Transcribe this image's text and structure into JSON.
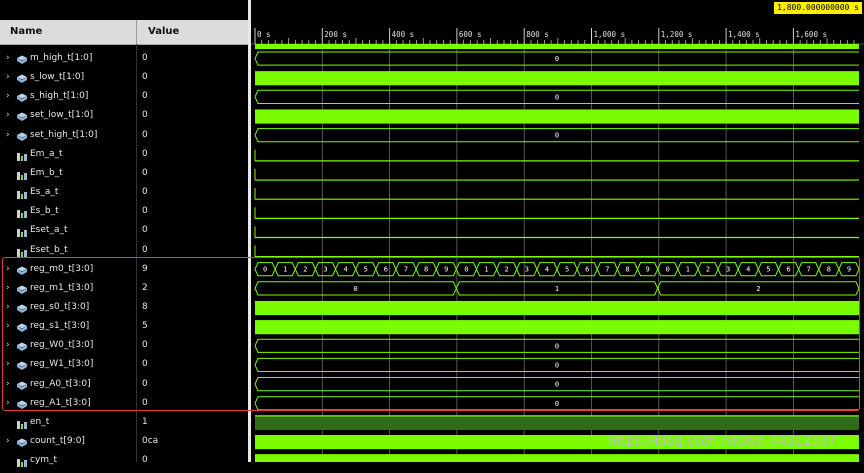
{
  "header": {
    "name_label": "Name",
    "value_label": "Value"
  },
  "cursor_time": "1,800.000000000 s",
  "ruler_ticks": [
    "0 s",
    "200 s",
    "400 s",
    "600 s",
    "800 s",
    "1,000 s",
    "1,200 s",
    "1,400 s",
    "1,600 s"
  ],
  "signals": [
    {
      "name": "m_high_t[1:0]",
      "value": "0",
      "bus": true,
      "kind": "bus",
      "text": "0"
    },
    {
      "name": "s_low_t[1:0]",
      "value": "0",
      "bus": true,
      "kind": "solid"
    },
    {
      "name": "s_high_t[1:0]",
      "value": "0",
      "bus": true,
      "kind": "bus",
      "text": "0"
    },
    {
      "name": "set_low_t[1:0]",
      "value": "0",
      "bus": true,
      "kind": "solid"
    },
    {
      "name": "set_high_t[1:0]",
      "value": "0",
      "bus": true,
      "kind": "bus",
      "text": "0"
    },
    {
      "name": "Em_a_t",
      "value": "0",
      "bus": false,
      "kind": "low"
    },
    {
      "name": "Em_b_t",
      "value": "0",
      "bus": false,
      "kind": "low"
    },
    {
      "name": "Es_a_t",
      "value": "0",
      "bus": false,
      "kind": "low"
    },
    {
      "name": "Es_b_t",
      "value": "0",
      "bus": false,
      "kind": "low"
    },
    {
      "name": "Eset_a_t",
      "value": "0",
      "bus": false,
      "kind": "low"
    },
    {
      "name": "Eset_b_t",
      "value": "0",
      "bus": false,
      "kind": "low"
    },
    {
      "name": "reg_m0_t[3:0]",
      "value": "9",
      "bus": true,
      "kind": "counter",
      "segments": [
        "0",
        "1",
        "2",
        "3",
        "4",
        "5",
        "6",
        "7",
        "8",
        "9",
        "0",
        "1",
        "2",
        "3",
        "4",
        "5",
        "6",
        "7",
        "8",
        "9",
        "0",
        "1",
        "2",
        "3",
        "4",
        "5",
        "6",
        "7",
        "8",
        "9"
      ]
    },
    {
      "name": "reg_m1_t[3:0]",
      "value": "2",
      "bus": true,
      "kind": "segments",
      "segments": [
        "0",
        "1",
        "2"
      ]
    },
    {
      "name": "reg_s0_t[3:0]",
      "value": "8",
      "bus": true,
      "kind": "solid"
    },
    {
      "name": "reg_s1_t[3:0]",
      "value": "5",
      "bus": true,
      "kind": "solid"
    },
    {
      "name": "reg_W0_t[3:0]",
      "value": "0",
      "bus": true,
      "kind": "bus",
      "text": "0"
    },
    {
      "name": "reg_W1_t[3:0]",
      "value": "0",
      "bus": true,
      "kind": "bus",
      "text": "0"
    },
    {
      "name": "reg_A0_t[3:0]",
      "value": "0",
      "bus": true,
      "kind": "bus",
      "text": "0"
    },
    {
      "name": "reg_A1_t[3:0]",
      "value": "0",
      "bus": true,
      "kind": "bus",
      "text": "0"
    },
    {
      "name": "en_t",
      "value": "1",
      "bus": false,
      "kind": "high"
    },
    {
      "name": "count_t[9:0]",
      "value": "0ca",
      "bus": true,
      "kind": "solid"
    },
    {
      "name": "cym_t",
      "value": "0",
      "bus": false,
      "kind": "partial"
    }
  ],
  "watermark": "https://blog.csdn.net/qq_44312507",
  "colors": {
    "wave_green": "#7cfc00",
    "highlight": "#e43a3a",
    "cursor_bg": "#ffee00"
  }
}
